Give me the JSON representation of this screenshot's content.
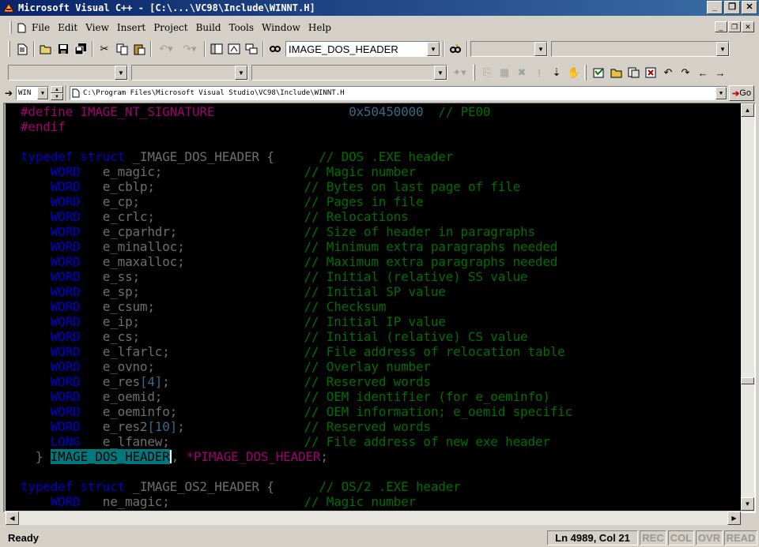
{
  "window": {
    "title": "Microsoft Visual C++ - [C:\\...\\VC98\\Include\\WINNT.H]",
    "controls": {
      "minimize": "_",
      "restore": "❐",
      "close": "✕"
    }
  },
  "menu": {
    "items": [
      "File",
      "Edit",
      "View",
      "Insert",
      "Project",
      "Build",
      "Tools",
      "Window",
      "Help"
    ]
  },
  "toolbar": {
    "find_combo_value": "IMAGE_DOS_HEADER"
  },
  "addressbar": {
    "target": "WIN",
    "path": "C:\\Program Files\\Microsoft Visual Studio\\VC98\\Include\\WINNT.H",
    "go_label": "Go"
  },
  "editor": {
    "lines": [
      {
        "seg": [
          [
            "mac",
            "#define IMAGE_NT_SIGNATURE"
          ],
          [
            "pu",
            "                  "
          ],
          [
            "num",
            "0x50450000"
          ],
          [
            "pu",
            "  "
          ],
          [
            "com",
            "// PE00"
          ]
        ]
      },
      {
        "seg": [
          [
            "mac",
            "#endif"
          ]
        ]
      },
      {
        "seg": []
      },
      {
        "seg": [
          [
            "kw",
            "typedef struct "
          ],
          [
            "id",
            "_IMAGE_DOS_HEADER {"
          ],
          [
            "pu",
            "      "
          ],
          [
            "com",
            "// DOS .EXE header"
          ]
        ]
      },
      {
        "seg": [
          [
            "ty",
            "    WORD   "
          ],
          [
            "id",
            "e_magic;"
          ],
          [
            "pu",
            "                   "
          ],
          [
            "com",
            "// Magic number"
          ]
        ]
      },
      {
        "seg": [
          [
            "ty",
            "    WORD   "
          ],
          [
            "id",
            "e_cblp;"
          ],
          [
            "pu",
            "                    "
          ],
          [
            "com",
            "// Bytes on last page of file"
          ]
        ]
      },
      {
        "seg": [
          [
            "ty",
            "    WORD   "
          ],
          [
            "id",
            "e_cp;"
          ],
          [
            "pu",
            "                      "
          ],
          [
            "com",
            "// Pages in file"
          ]
        ]
      },
      {
        "seg": [
          [
            "ty",
            "    WORD   "
          ],
          [
            "id",
            "e_crlc;"
          ],
          [
            "pu",
            "                    "
          ],
          [
            "com",
            "// Relocations"
          ]
        ]
      },
      {
        "seg": [
          [
            "ty",
            "    WORD   "
          ],
          [
            "id",
            "e_cparhdr;"
          ],
          [
            "pu",
            "                 "
          ],
          [
            "com",
            "// Size of header in paragraphs"
          ]
        ]
      },
      {
        "seg": [
          [
            "ty",
            "    WORD   "
          ],
          [
            "id",
            "e_minalloc;"
          ],
          [
            "pu",
            "                "
          ],
          [
            "com",
            "// Minimum extra paragraphs needed"
          ]
        ]
      },
      {
        "seg": [
          [
            "ty",
            "    WORD   "
          ],
          [
            "id",
            "e_maxalloc;"
          ],
          [
            "pu",
            "                "
          ],
          [
            "com",
            "// Maximum extra paragraphs needed"
          ]
        ]
      },
      {
        "seg": [
          [
            "ty",
            "    WORD   "
          ],
          [
            "id",
            "e_ss;"
          ],
          [
            "pu",
            "                      "
          ],
          [
            "com",
            "// Initial (relative) SS value"
          ]
        ]
      },
      {
        "seg": [
          [
            "ty",
            "    WORD   "
          ],
          [
            "id",
            "e_sp;"
          ],
          [
            "pu",
            "                      "
          ],
          [
            "com",
            "// Initial SP value"
          ]
        ]
      },
      {
        "seg": [
          [
            "ty",
            "    WORD   "
          ],
          [
            "id",
            "e_csum;"
          ],
          [
            "pu",
            "                    "
          ],
          [
            "com",
            "// Checksum"
          ]
        ]
      },
      {
        "seg": [
          [
            "ty",
            "    WORD   "
          ],
          [
            "id",
            "e_ip;"
          ],
          [
            "pu",
            "                      "
          ],
          [
            "com",
            "// Initial IP value"
          ]
        ]
      },
      {
        "seg": [
          [
            "ty",
            "    WORD   "
          ],
          [
            "id",
            "e_cs;"
          ],
          [
            "pu",
            "                      "
          ],
          [
            "com",
            "// Initial (relative) CS value"
          ]
        ]
      },
      {
        "seg": [
          [
            "ty",
            "    WORD   "
          ],
          [
            "id",
            "e_lfarlc;"
          ],
          [
            "pu",
            "                  "
          ],
          [
            "com",
            "// File address of relocation table"
          ]
        ]
      },
      {
        "seg": [
          [
            "ty",
            "    WORD   "
          ],
          [
            "id",
            "e_ovno;"
          ],
          [
            "pu",
            "                    "
          ],
          [
            "com",
            "// Overlay number"
          ]
        ]
      },
      {
        "seg": [
          [
            "ty",
            "    WORD   "
          ],
          [
            "id",
            "e_res"
          ],
          [
            "num",
            "[4]"
          ],
          [
            "id",
            ";"
          ],
          [
            "pu",
            "                  "
          ],
          [
            "com",
            "// Reserved words"
          ]
        ]
      },
      {
        "seg": [
          [
            "ty",
            "    WORD   "
          ],
          [
            "id",
            "e_oemid;"
          ],
          [
            "pu",
            "                   "
          ],
          [
            "com",
            "// OEM identifier (for e_oeminfo)"
          ]
        ]
      },
      {
        "seg": [
          [
            "ty",
            "    WORD   "
          ],
          [
            "id",
            "e_oeminfo;"
          ],
          [
            "pu",
            "                 "
          ],
          [
            "com",
            "// OEM information; e_oemid specific"
          ]
        ]
      },
      {
        "seg": [
          [
            "ty",
            "    WORD   "
          ],
          [
            "id",
            "e_res2"
          ],
          [
            "num",
            "[10]"
          ],
          [
            "id",
            ";"
          ],
          [
            "pu",
            "                "
          ],
          [
            "com",
            "// Reserved words"
          ]
        ]
      },
      {
        "seg": [
          [
            "ty",
            "    LONG   "
          ],
          [
            "id",
            "e_lfanew;"
          ],
          [
            "pu",
            "                  "
          ],
          [
            "com",
            "// File address of new exe header"
          ]
        ]
      },
      {
        "seg": [
          [
            "id",
            "  } "
          ],
          [
            "sel",
            "IMAGE_DOS_HEADER"
          ],
          [
            "caret",
            ""
          ],
          [
            "id",
            ", "
          ],
          [
            "mac",
            "*PIMAGE_DOS_HEADER"
          ],
          [
            "id",
            ";"
          ]
        ]
      },
      {
        "seg": []
      },
      {
        "seg": [
          [
            "kw",
            "typedef struct "
          ],
          [
            "id",
            "_IMAGE_OS2_HEADER {"
          ],
          [
            "pu",
            "      "
          ],
          [
            "com",
            "// OS/2 .EXE header"
          ]
        ]
      },
      {
        "seg": [
          [
            "ty",
            "    WORD   "
          ],
          [
            "id",
            "ne_magic;"
          ],
          [
            "pu",
            "                  "
          ],
          [
            "com",
            "// Magic number"
          ]
        ]
      }
    ]
  },
  "colors": {
    "keyword": "#0000d0",
    "macro": "#a00070",
    "comment": "#006e00",
    "identifier": "#6e6e6e",
    "number": "#3a6a88",
    "selection": "#00787c",
    "editor_bg": "#000000"
  },
  "status": {
    "ready": "Ready",
    "position": "Ln 4989, Col 21",
    "rec": "REC",
    "col": "COL",
    "ovr": "OVR",
    "read": "READ"
  },
  "icons": [
    "vc-app-icon",
    "new-file-icon",
    "open-folder-icon",
    "save-icon",
    "save-all-icon",
    "cut-icon",
    "copy-icon",
    "paste-icon",
    "undo-icon",
    "redo-icon",
    "workspace-icon",
    "output-icon",
    "window-list-icon",
    "find-in-files-icon",
    "find-icon",
    "compile-icon",
    "build-icon",
    "stop-build-icon",
    "execute-icon",
    "go-icon",
    "insert-breakpoint-icon",
    "hand-icon",
    "class-view-icon",
    "folder-icon",
    "file-icon",
    "wizard-icon",
    "goto-icon",
    "bookmark-icon",
    "back-icon",
    "forward-icon",
    "dropdown-arrow-icon",
    "scroll-up-icon",
    "scroll-down-icon",
    "scroll-left-icon",
    "scroll-right-icon"
  ]
}
